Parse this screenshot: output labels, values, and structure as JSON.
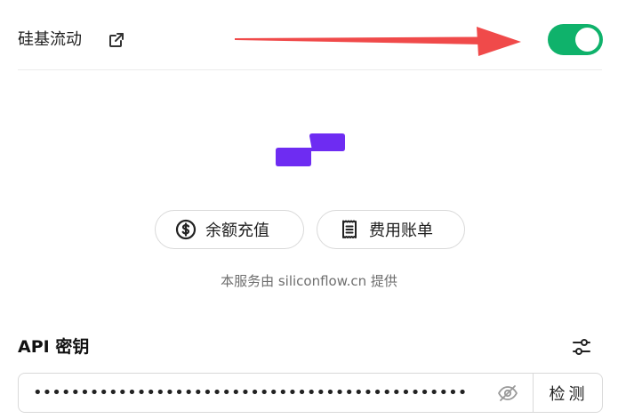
{
  "header": {
    "provider_name": "硅基流动",
    "enabled": true
  },
  "actions": {
    "recharge_label": "余额充值",
    "bills_label": "费用账单"
  },
  "footer_note": "本服务由 siliconflow.cn 提供",
  "api_key": {
    "label": "API 密钥",
    "value": "••••••••••••••••••••••••••••••••••••••••••••••",
    "check_label": "检测"
  },
  "colors": {
    "toggle_on": "#0fb26b",
    "brand_purple": "#6e2cf2",
    "annotation_arrow": "#f04a4a"
  },
  "icons": {
    "external_link": "external-link-icon",
    "dollar": "dollar-circle-icon",
    "receipt": "receipt-icon",
    "settings": "settings-sliders-icon",
    "eye_off": "eye-off-icon"
  }
}
